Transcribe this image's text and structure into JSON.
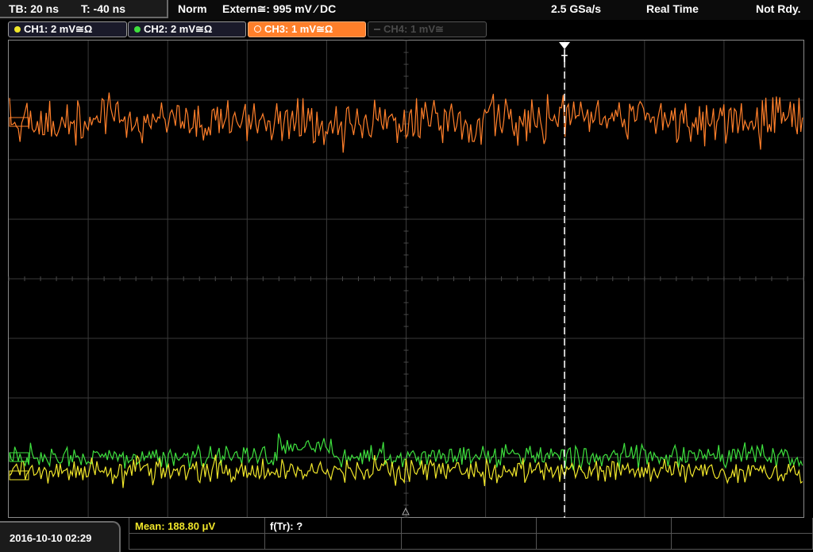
{
  "status_bar": {
    "timebase": "TB: 20 ns",
    "trigger_offset": "T: -40 ns",
    "trigger_mode": "Norm",
    "trigger_source": "Extern≅: 995 mV ⁄ DC",
    "sample_rate": "2.5 GSa/s",
    "acquisition": "Real Time",
    "ready_state": "Not Rdy."
  },
  "channels": [
    {
      "label": "CH1: 2 mV≅Ω",
      "color": "#f0e62a",
      "active": false,
      "enabled": true
    },
    {
      "label": "CH2: 2 mV≅Ω",
      "color": "#3ee03e",
      "active": false,
      "enabled": true
    },
    {
      "label": "CH3: 1 mV≅Ω",
      "color": "#ff7f2a",
      "active": true,
      "enabled": true
    },
    {
      "label": "CH4: 1 mV≅",
      "color": "#555555",
      "active": false,
      "enabled": false
    }
  ],
  "markers": {
    "trigger_letter": "T"
  },
  "measurements": {
    "mean": "Mean: 188.80 μV",
    "trigger_freq": "f(Tr): ?"
  },
  "footer": {
    "datetime": "2016-10-10 02:29"
  },
  "colors": {
    "ch1": "#f0e62a",
    "ch2": "#3ee03e",
    "ch3": "#ff7f2a",
    "grid": "#3a3a3a",
    "accent": "#ff7f2a"
  }
}
